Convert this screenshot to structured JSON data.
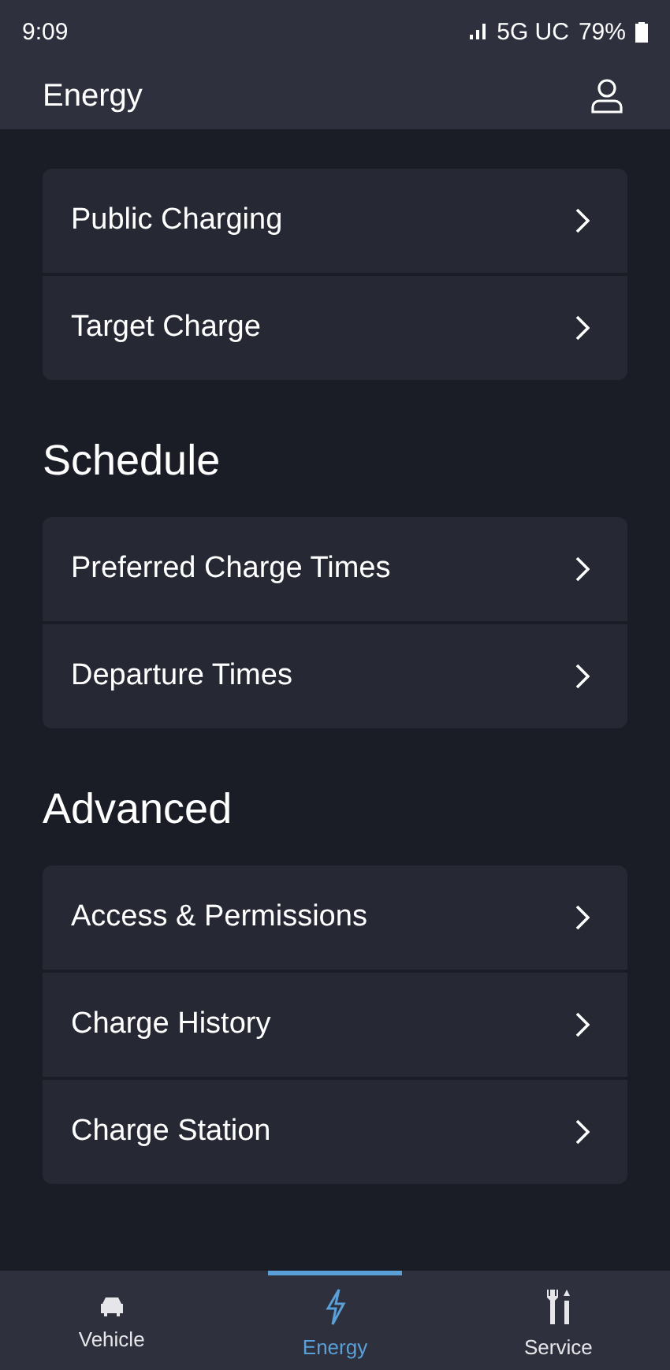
{
  "status_bar": {
    "time": "9:09",
    "network": "5G UC",
    "battery": "79%"
  },
  "header": {
    "title": "Energy"
  },
  "sections": [
    {
      "items": [
        "Public Charging",
        "Target Charge"
      ]
    },
    {
      "title": "Schedule",
      "items": [
        "Preferred Charge Times",
        "Departure Times"
      ]
    },
    {
      "title": "Advanced",
      "items": [
        "Access & Permissions",
        "Charge History",
        "Charge Station"
      ]
    }
  ],
  "nav": [
    {
      "label": "Vehicle",
      "kind": "vehicle",
      "selected": false
    },
    {
      "label": "Energy",
      "kind": "energy",
      "selected": true
    },
    {
      "label": "Service",
      "kind": "service",
      "selected": false
    }
  ]
}
